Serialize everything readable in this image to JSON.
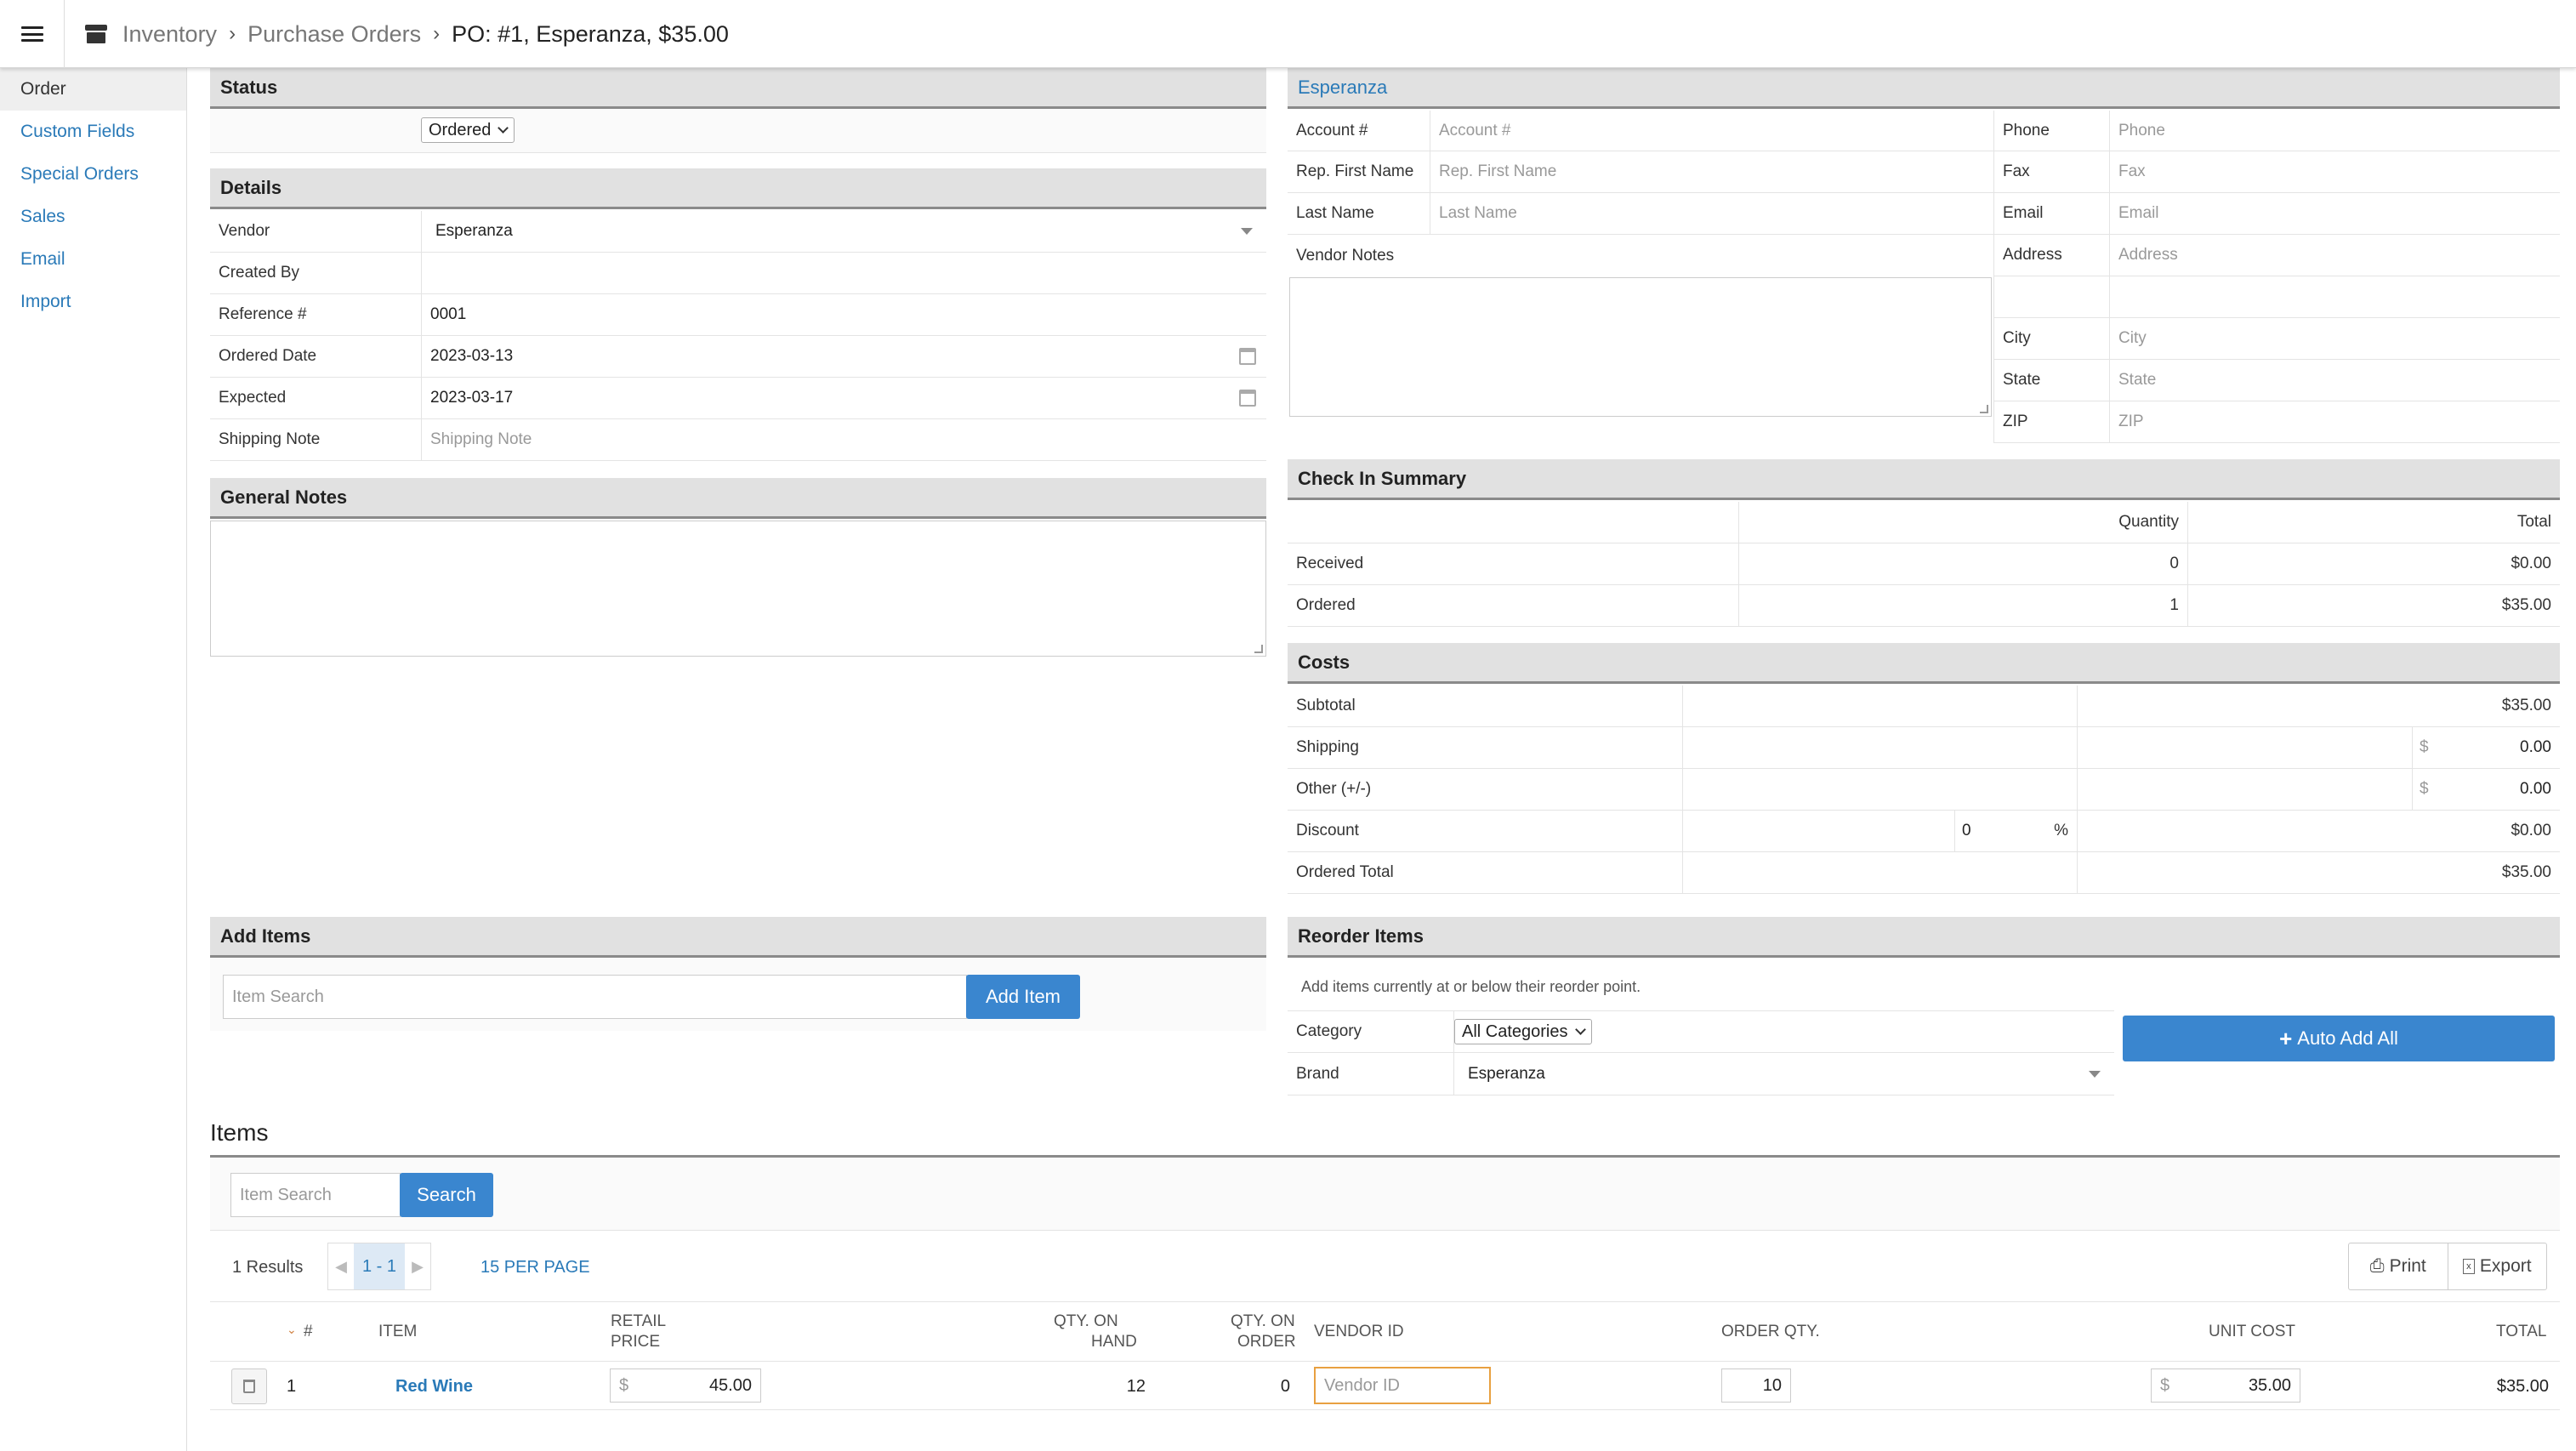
{
  "breadcrumb": {
    "root": "Inventory",
    "section": "Purchase Orders",
    "current": "PO: #1, Esperanza, $35.00"
  },
  "sidebar": {
    "items": [
      {
        "label": "Order"
      },
      {
        "label": "Custom Fields"
      },
      {
        "label": "Special Orders"
      },
      {
        "label": "Sales"
      },
      {
        "label": "Email"
      },
      {
        "label": "Import"
      }
    ]
  },
  "status": {
    "title": "Status",
    "value": "Ordered"
  },
  "details": {
    "title": "Details",
    "vendor_label": "Vendor",
    "vendor_value": "Esperanza",
    "created_by_label": "Created By",
    "reference_label": "Reference #",
    "reference_value": "0001",
    "ordered_date_label": "Ordered Date",
    "ordered_date_value": "2023-03-13",
    "expected_label": "Expected",
    "expected_value": "2023-03-17",
    "shipping_note_label": "Shipping Note",
    "shipping_note_placeholder": "Shipping Note"
  },
  "general_notes": {
    "title": "General Notes"
  },
  "vendor": {
    "title": "Esperanza",
    "account_label": "Account #",
    "account_placeholder": "Account #",
    "rep_first_label": "Rep. First Name",
    "rep_first_placeholder": "Rep. First Name",
    "last_name_label": "Last Name",
    "last_name_placeholder": "Last Name",
    "notes_label": "Vendor Notes",
    "phone_label": "Phone",
    "phone_placeholder": "Phone",
    "fax_label": "Fax",
    "fax_placeholder": "Fax",
    "email_label": "Email",
    "email_placeholder": "Email",
    "address_label": "Address",
    "address_placeholder": "Address",
    "city_label": "City",
    "city_placeholder": "City",
    "state_label": "State",
    "state_placeholder": "State",
    "zip_label": "ZIP",
    "zip_placeholder": "ZIP"
  },
  "checkin": {
    "title": "Check In Summary",
    "qty_header": "Quantity",
    "total_header": "Total",
    "received_label": "Received",
    "received_qty": "0",
    "received_total": "$0.00",
    "ordered_label": "Ordered",
    "ordered_qty": "1",
    "ordered_total": "$35.00"
  },
  "costs": {
    "title": "Costs",
    "subtotal_label": "Subtotal",
    "subtotal_value": "$35.00",
    "shipping_label": "Shipping",
    "shipping_currency": "$",
    "shipping_value": "0.00",
    "other_label": "Other (+/-)",
    "other_currency": "$",
    "other_value": "0.00",
    "discount_label": "Discount",
    "discount_input": "0",
    "discount_percent": "%",
    "discount_value": "$0.00",
    "ordered_total_label": "Ordered Total",
    "ordered_total_value": "$35.00"
  },
  "add_items": {
    "title": "Add Items",
    "search_placeholder": "Item Search",
    "add_button": "Add Item"
  },
  "reorder": {
    "title": "Reorder Items",
    "hint": "Add items currently at or below their reorder point.",
    "category_label": "Category",
    "category_value": "All Categories",
    "brand_label": "Brand",
    "brand_value": "Esperanza",
    "auto_add_button": "Auto Add All"
  },
  "items": {
    "title": "Items",
    "search_placeholder": "Item Search",
    "search_button": "Search",
    "results": "1 Results",
    "page_range": "1 - 1",
    "per_page": "15 PER PAGE",
    "print_button": "Print",
    "export_button": "Export",
    "headers": {
      "num": "#",
      "item": "ITEM",
      "retail_1": "RETAIL",
      "retail_2": "PRICE",
      "qoh_1": "QTY. ON",
      "qoh_2": "HAND",
      "qoo_1": "QTY. ON",
      "qoo_2": "ORDER",
      "vendor_id": "VENDOR ID",
      "order_qty": "ORDER QTY.",
      "unit_cost": "UNIT COST",
      "total": "TOTAL"
    },
    "rows": [
      {
        "num": "1",
        "item": "Red Wine",
        "retail_currency": "$",
        "retail_price": "45.00",
        "qty_on_hand": "12",
        "qty_on_order": "0",
        "vendor_id_placeholder": "Vendor ID",
        "order_qty": "10",
        "unit_currency": "$",
        "unit_cost": "35.00",
        "total": "$35.00"
      }
    ]
  }
}
